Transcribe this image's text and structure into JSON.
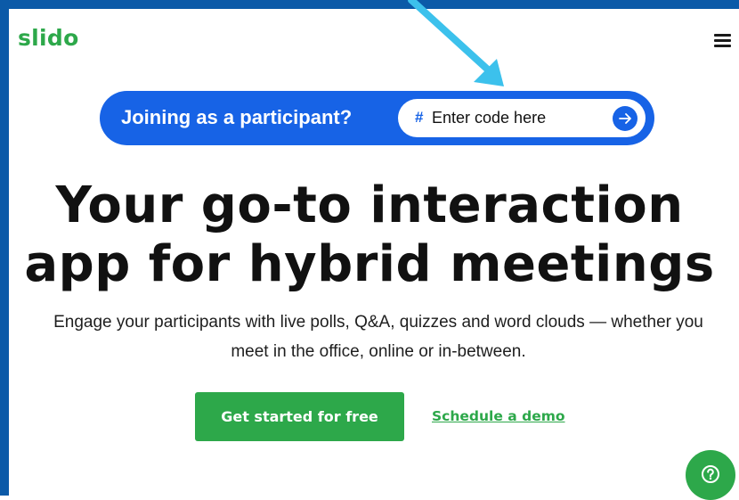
{
  "header": {
    "logo_text": "slido",
    "menu_icon": "hamburger-menu-icon"
  },
  "join": {
    "label": "Joining as a participant?",
    "hash_symbol": "#",
    "code_placeholder": "Enter code here",
    "code_value": "",
    "submit_icon": "arrow-right-icon"
  },
  "hero": {
    "headline": "Your go-to interaction app for hybrid meetings",
    "subtitle": "Engage your participants with live polls, Q&A, quizzes and word clouds — whether you meet in the office, online or in-between."
  },
  "actions": {
    "primary_label": "Get started for free",
    "secondary_label": "Schedule a demo"
  },
  "help": {
    "icon": "question-mark-icon"
  },
  "colors": {
    "brand_green": "#2da84a",
    "join_blue": "#1763e6",
    "frame_blue": "#0b5aa8",
    "annotation_arrow": "#3cc1ec"
  }
}
